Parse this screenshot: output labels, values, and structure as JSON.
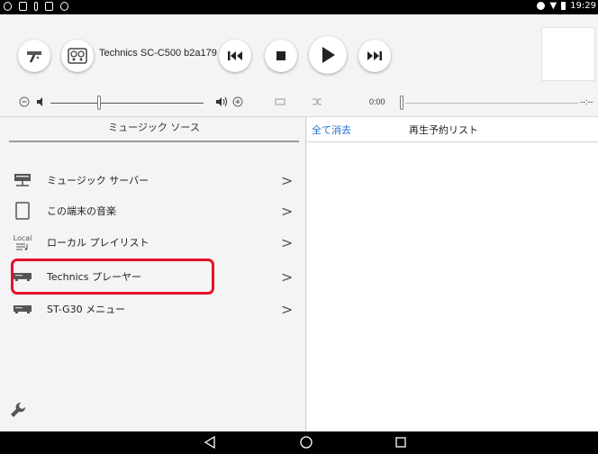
{
  "status_bar": {
    "time": "19:29"
  },
  "player": {
    "device_name": "Technics SC-C500 b2a179",
    "position_time": "0:00",
    "remaining_time": "--:--"
  },
  "source_panel": {
    "title": "ミュージック ソース",
    "items": [
      {
        "label": "ミュージック サーバー",
        "icon": "music-server-icon"
      },
      {
        "label": "この端末の音楽",
        "icon": "tablet-icon"
      },
      {
        "label": "ローカル プレイリスト",
        "icon": "local-playlist-icon",
        "icon_text": "Local"
      },
      {
        "label": "Technics プレーヤー",
        "icon": "technics-player-icon"
      },
      {
        "label": "ST-G30 メニュー",
        "icon": "st-g30-device-icon"
      }
    ],
    "chevron": ">"
  },
  "queue_panel": {
    "clear_all": "全て消去",
    "title": "再生予約リスト"
  },
  "colors": {
    "accent_link": "#1e6fd9",
    "highlight": "#e8102a"
  }
}
